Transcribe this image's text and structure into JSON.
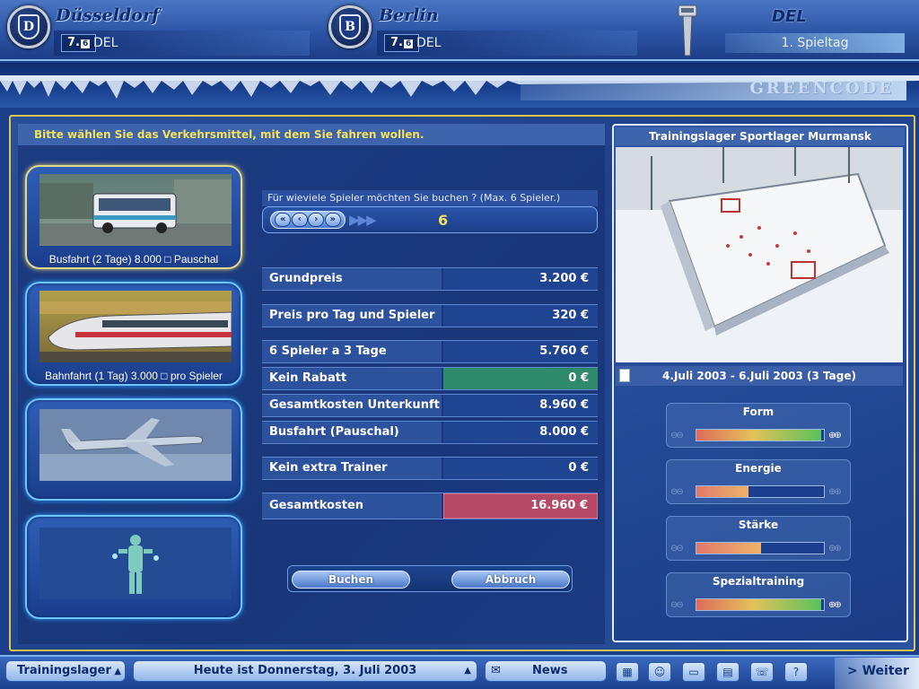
{
  "header": {
    "home_team": {
      "name": "Düsseldorf",
      "rating": "7.",
      "rating_small": "6",
      "league": "DEL",
      "logo_letter": "D"
    },
    "away_team": {
      "name": "Berlin",
      "rating": "7.",
      "rating_small": "6",
      "league": "DEL",
      "logo_letter": "B"
    },
    "league_title": "DEL",
    "matchday": "1. Spieltag",
    "brand": "GREENCODE"
  },
  "left": {
    "instruction": "Bitte wählen Sie das Verkehrsmittel, mit dem Sie fahren wollen.",
    "transport_options": [
      {
        "caption": "Busfahrt (2 Tage) 8.000 □ Pauschal",
        "picture": "bus",
        "selected": true
      },
      {
        "caption": "Bahnfahrt (1 Tag)  3.000 □ pro Spieler",
        "picture": "train",
        "selected": false
      },
      {
        "caption": "",
        "picture": "airplane",
        "selected": false
      },
      {
        "caption": "",
        "picture": "player-figure",
        "selected": false
      }
    ]
  },
  "booking": {
    "question": "Für wieviele Spieler möchten Sie buchen ? (Max. 6 Spieler.)",
    "stepper_buttons": [
      "«",
      "‹",
      "›",
      "»"
    ],
    "stepper_value": "6",
    "rows": [
      {
        "label": "Grundpreis",
        "value": "3.200 €",
        "style": "normal"
      },
      {
        "label": "Preis pro Tag und Spieler",
        "value": "320 €",
        "style": "normal"
      },
      {
        "label": "6 Spieler a 3 Tage",
        "value": "5.760 €",
        "style": "normal"
      },
      {
        "label": "Kein Rabatt",
        "value": "0 €",
        "style": "green"
      },
      {
        "label": "Gesamtkosten Unterkunft",
        "value": "8.960 €",
        "style": "normal"
      },
      {
        "label": "Busfahrt (Pauschal)",
        "value": "8.000 €",
        "style": "normal"
      },
      {
        "label": "Kein extra Trainer",
        "value": "0 €",
        "style": "normal"
      },
      {
        "label": "Gesamtkosten",
        "value": "16.960 €",
        "style": "red"
      }
    ],
    "book_label": "Buchen",
    "cancel_label": "Abbruch"
  },
  "camp": {
    "title": "Trainingslager Sportlager Murmansk",
    "dates": "4.Juli 2003 - 6.Juli 2003 (3 Tage)",
    "stats": [
      {
        "name": "Form",
        "level": 0.98,
        "bar_color": "gradient-green"
      },
      {
        "name": "Energie",
        "level": 0.41,
        "bar_color": "orange"
      },
      {
        "name": "Stärke",
        "level": 0.51,
        "bar_color": "orange"
      },
      {
        "name": "Spezialtraining",
        "level": 0.98,
        "bar_color": "gradient-green"
      }
    ]
  },
  "bottom": {
    "section": "Trainingslager",
    "status": "Heute ist Donnerstag, 3. Juli 2003",
    "news": "News",
    "icons": [
      "calendar-icon",
      "person-icon",
      "monitor-icon",
      "board-icon",
      "phone-icon",
      "help-icon"
    ],
    "next": "Weiter"
  },
  "colors": {
    "accent_yellow": "#f2e15a",
    "gold_border": "#e0c54b",
    "discount_green": "#2f8a6c",
    "total_red": "#b64a66"
  }
}
